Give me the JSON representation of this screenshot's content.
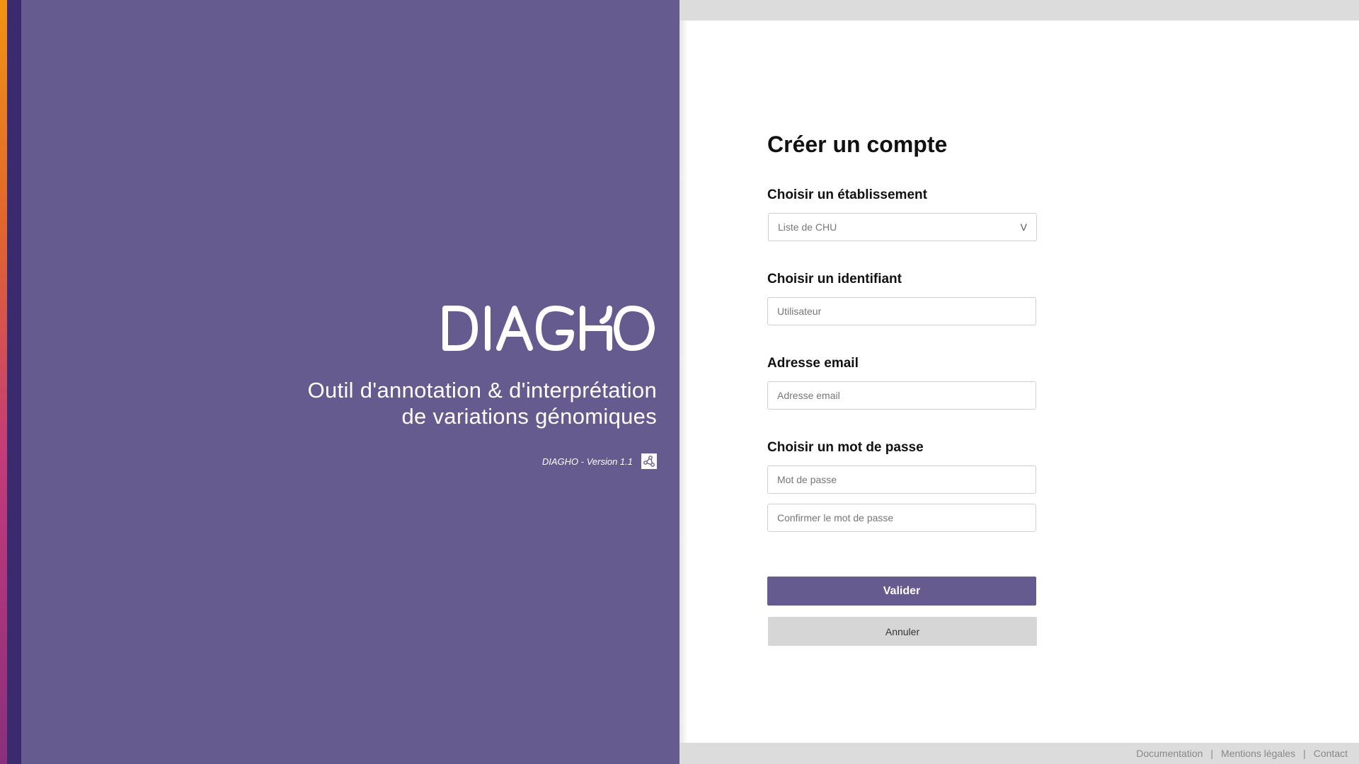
{
  "brand": {
    "logo_text": "DIAGHO",
    "tagline_line1": "Outil d'annotation & d'interprétation",
    "tagline_line2": "de variations génomiques",
    "version": "DIAGHO - Version 1.1",
    "colors": {
      "primary": "#665b8f",
      "dark_stripe": "#3b2a6e",
      "accent_top": "#f39312",
      "accent_bottom": "#8a2f7c"
    }
  },
  "form": {
    "title": "Créer un compte",
    "establishment_label": "Choisir un établissement",
    "establishment_select": "Liste de CHU",
    "identifier_label": "Choisir un identifiant",
    "identifier_placeholder": "Utilisateur",
    "email_label": "Adresse email",
    "email_placeholder": "Adresse email",
    "password_label": "Choisir un mot de passe",
    "password_placeholder": "Mot de passe",
    "password_confirm_placeholder": "Confirmer le mot de passe",
    "submit_label": "Valider",
    "cancel_label": "Annuler"
  },
  "footer": {
    "links": [
      "Documentation",
      "Mentions légales",
      "Contact"
    ],
    "separator": "|"
  }
}
